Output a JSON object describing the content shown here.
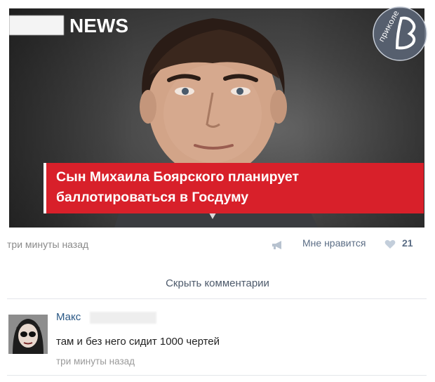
{
  "post": {
    "image": {
      "brand_label": "NEWS",
      "headline_line1": "Сын Михаила Боярского планирует",
      "headline_line2": "баллотироваться в Госдуму",
      "watermark_text": "приколе"
    },
    "time": "три минуты назад",
    "like_label": "Мне нравится",
    "like_count": "21",
    "hide_comments_label": "Скрыть комментарии"
  },
  "comment": {
    "author": "Макс",
    "text": "там и без него сидит 1000 чертей",
    "time": "три минуты назад"
  },
  "colors": {
    "headline_red": "#d8202a",
    "link_blue": "#2a5885",
    "muted_gray": "#8a8a8a"
  },
  "icons": {
    "share": "megaphone-icon",
    "like": "heart-icon",
    "watermark": "watermark-logo-icon"
  }
}
